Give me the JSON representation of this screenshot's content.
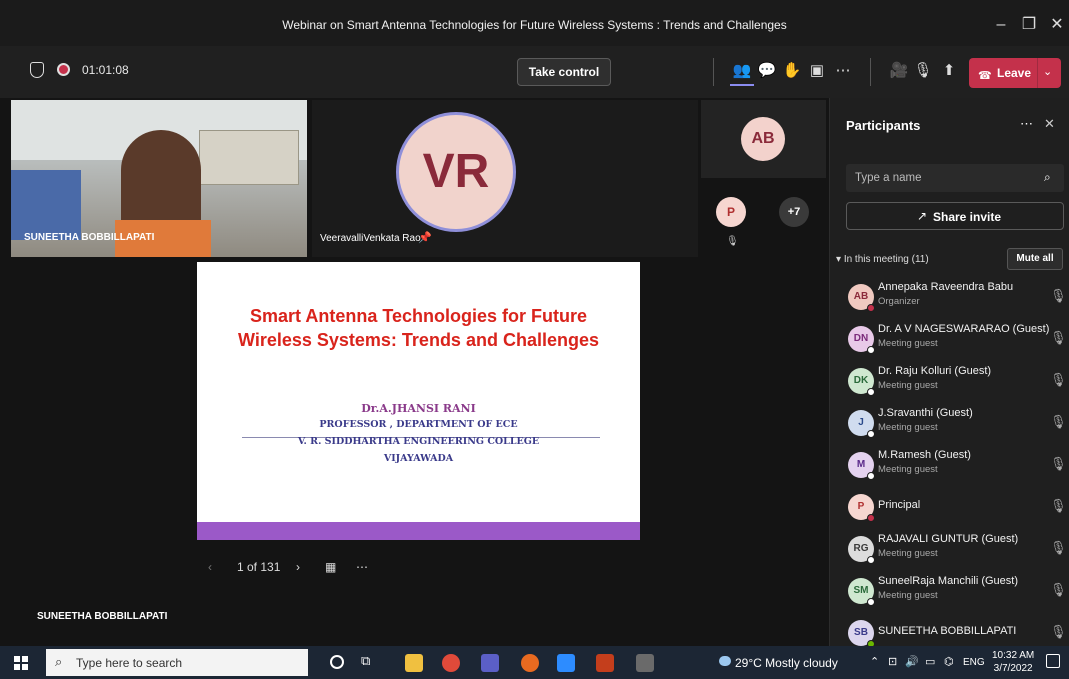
{
  "window": {
    "title": "Webinar on Smart Antenna Technologies for Future Wireless Systems : Trends and Challenges"
  },
  "toolbar": {
    "timer": "01:01:08",
    "take_control": "Take control",
    "leave": "Leave"
  },
  "stage": {
    "tile_camera_name": "SUNEETHA BOBBILLAPATI",
    "tile_vr_initials": "VR",
    "tile_vr_name": "VeeravalliVenkata Rao",
    "tile_ab_initials": "AB",
    "tile_p_initials": "P",
    "overflow_count": "+7",
    "presenter_label": "SUNEETHA BOBBILLAPATI"
  },
  "slide": {
    "title_line1": "Smart Antenna Technologies for Future",
    "title_line2": "Wireless Systems: Trends and Challenges",
    "author": "Dr.A.JHANSI RANI",
    "position": "PROFESSOR , DEPARTMENT OF  ECE",
    "college": "V. R. SIDDHARTHA ENGINEERING COLLEGE",
    "city": "VIJAYAWADA"
  },
  "pager": {
    "page": "1 of 131"
  },
  "panel": {
    "title": "Participants",
    "search_placeholder": "Type a name",
    "share_invite": "Share invite",
    "in_meeting": "In this meeting (11)",
    "mute_all": "Mute all",
    "participants": [
      {
        "initials": "AB",
        "name": "Annepaka Raveendra Babu",
        "role": "Organizer",
        "avatar_color": "#f0c9c0",
        "text_color": "#8a2a3a",
        "dot": "#c4314b"
      },
      {
        "initials": "DN",
        "name": "Dr. A V NAGESWARARAO (Guest)",
        "role": "Meeting guest",
        "avatar_color": "#e8c9e8",
        "text_color": "#7a2a7a",
        "dot": "#ffffff"
      },
      {
        "initials": "DK",
        "name": "Dr. Raju Kolluri (Guest)",
        "role": "Meeting guest",
        "avatar_color": "#cfe8d0",
        "text_color": "#2a6a3a",
        "dot": "#ffffff"
      },
      {
        "initials": "J",
        "name": "J.Sravanthi (Guest)",
        "role": "Meeting guest",
        "avatar_color": "#d0dcef",
        "text_color": "#2a4a8a",
        "dot": "#ffffff"
      },
      {
        "initials": "M",
        "name": "M.Ramesh (Guest)",
        "role": "Meeting guest",
        "avatar_color": "#e4d2ef",
        "text_color": "#5a2a8a",
        "dot": "#ffffff"
      },
      {
        "initials": "P",
        "name": "Principal",
        "role": "",
        "avatar_color": "#f6d6d0",
        "text_color": "#b03030",
        "dot": "#c4314b"
      },
      {
        "initials": "RG",
        "name": "RAJAVALI GUNTUR (Guest)",
        "role": "Meeting guest",
        "avatar_color": "#dcdcdc",
        "text_color": "#3a3a3a",
        "dot": "#ffffff"
      },
      {
        "initials": "SM",
        "name": "SuneelRaja Manchili (Guest)",
        "role": "Meeting guest",
        "avatar_color": "#cfe8d0",
        "text_color": "#2a6a3a",
        "dot": "#ffffff"
      },
      {
        "initials": "SB",
        "name": "SUNEETHA BOBBILLAPATI",
        "role": "",
        "avatar_color": "#dcd6ee",
        "text_color": "#3a3a8a",
        "dot": "#6bb700"
      }
    ]
  },
  "taskbar": {
    "search_placeholder": "Type here to search",
    "weather": "29°C  Mostly cloudy",
    "lang": "ENG",
    "time": "10:32 AM",
    "date": "3/7/2022"
  },
  "colors": {
    "leave": "#c4314b",
    "accent": "#6264a7",
    "slide_bar": "#9b59c8"
  }
}
